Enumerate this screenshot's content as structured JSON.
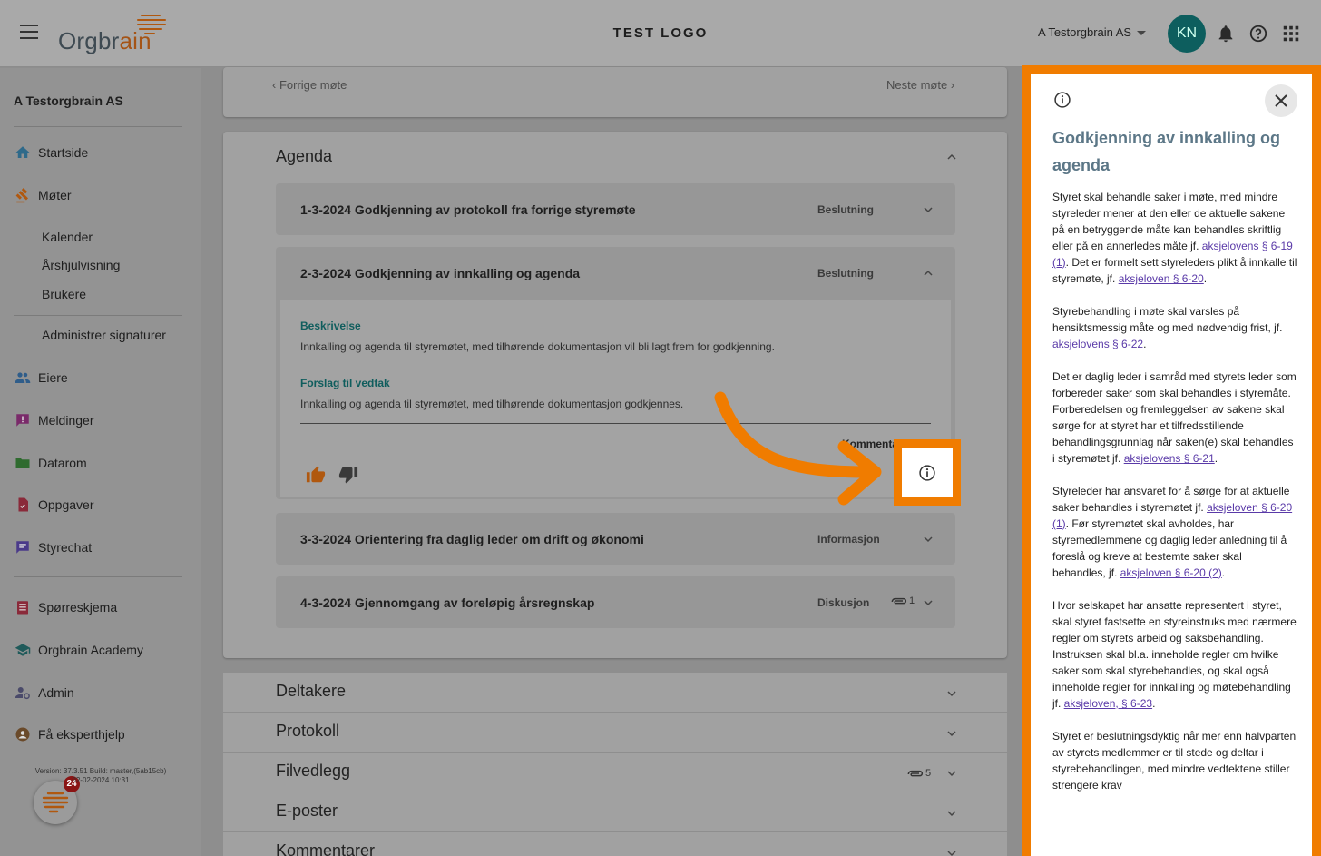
{
  "header": {
    "logo_text_a": "Orgbr",
    "logo_text_b": "ain",
    "center_title": "TEST LOGO",
    "org_selector": "A Testorgbrain AS",
    "avatar_initials": "KN"
  },
  "sidebar": {
    "org_name": "A Testorgbrain AS",
    "items": {
      "startside": "Startside",
      "moter": "Møter",
      "kalender": "Kalender",
      "arshjul": "Årshjulvisning",
      "brukere": "Brukere",
      "signaturer": "Administrer signaturer",
      "eiere": "Eiere",
      "meldinger": "Meldinger",
      "datarom": "Datarom",
      "oppgaver": "Oppgaver",
      "styrechat": "Styrechat",
      "sporreskjema": "Spørreskjema",
      "academy": "Orgbrain Academy",
      "admin": "Admin",
      "ekspert": "Få eksperthjelp"
    },
    "version_line1": "Version: 37.3.51 Build: master,(5ab15cb)",
    "version_line2": "02-02-2024 10:31",
    "fab_badge": "24"
  },
  "meeting_nav": {
    "prev": "Forrige møte",
    "next": "Neste møte"
  },
  "agenda": {
    "title": "Agenda",
    "items": [
      {
        "title": "1-3-2024 Godkjenning av protokoll fra forrige styremøte",
        "type": "Beslutning"
      },
      {
        "title": "2-3-2024 Godkjenning av innkalling og agenda",
        "type": "Beslutning"
      },
      {
        "title": "3-3-2024 Orientering fra daglig leder om drift og økonomi",
        "type": "Informasjon"
      },
      {
        "title": "4-3-2024 Gjennomgang av foreløpig årsregnskap",
        "type": "Diskusjon",
        "attachments": "1"
      }
    ],
    "expanded": {
      "desc_heading": "Beskrivelse",
      "desc_text": "Innkalling og agenda til styremøtet, med tilhørende dokumentasjon vil bli lagt frem for godkjenning.",
      "proposal_heading": "Forslag til vedtak",
      "proposal_text": "Innkalling og agenda til styremøtet, med tilhørende dokumentasjon godkjennes.",
      "comment_label": "Kommentar"
    }
  },
  "sections": {
    "deltakere": "Deltakere",
    "protokoll": "Protokoll",
    "filvedlegg": "Filvedlegg",
    "filvedlegg_count": "5",
    "eposter": "E-poster",
    "kommentarer": "Kommentarer"
  },
  "panel": {
    "title": "Godkjenning av innkalling og agenda",
    "p1a": "Styret skal behandle saker i møte, med mindre styreleder mener at den eller de aktuelle sakene på en betryggende måte kan behandles skriftlig eller på en annerledes måte jf. ",
    "p1link1": "aksjelovens § 6-19 (1)",
    "p1b": ". Det er formelt sett styreleders plikt å innkalle til styremøte, jf. ",
    "p1link2": "aksjeloven § 6-20",
    "p1c": ".",
    "p2a": "Styrebehandling i møte skal varsles på hensiktsmessig måte og med nødvendig frist, jf. ",
    "p2link": "aksjelovens § 6-22",
    "p2b": ".",
    "p3a": "Det er daglig leder i samråd med styrets leder som forbereder saker som skal behandles i styremåte. Forberedelsen og fremleggelsen av sakene skal sørge for at styret har et tilfredsstillende behandlingsgrunnlag når saken(e) skal behandles i styremøtet jf. ",
    "p3link": "aksjelovens § 6-21",
    "p3b": ".",
    "p4a": "Styreleder har ansvaret for å sørge for at aktuelle saker behandles i styremøtet jf. ",
    "p4link1": "aksjeloven § 6-20 (1)",
    "p4b": ". Før styremøtet skal avholdes, har styremedlemmene og daglig leder anledning til å foreslå og kreve at bestemte saker skal behandles, jf. ",
    "p4link2": "aksjeloven § 6-20 (2)",
    "p4c": ".",
    "p5a": "Hvor selskapet har ansatte representert i styret, skal styret fastsette en styreinstruks med nærmere regler om styrets arbeid og saksbehandling. Instruksen skal bl.a. inneholde regler om hvilke saker som skal styrebehandles, og skal også inneholde regler for innkalling og møtebehandling jf. ",
    "p5link": "aksjeloven, § 6-23",
    "p5b": ".",
    "p6": "Styret er beslutningsdyktig når mer enn halvparten av styrets medlemmer er til stede og deltar i styrebehandlingen, med mindre vedtektene stiller strengere krav"
  }
}
